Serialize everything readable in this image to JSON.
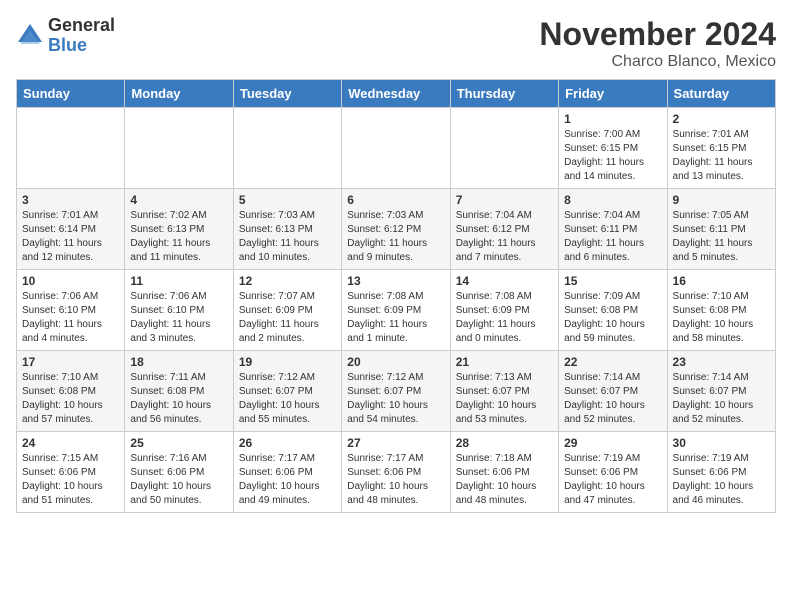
{
  "header": {
    "logo_general": "General",
    "logo_blue": "Blue",
    "month_title": "November 2024",
    "location": "Charco Blanco, Mexico"
  },
  "weekdays": [
    "Sunday",
    "Monday",
    "Tuesday",
    "Wednesday",
    "Thursday",
    "Friday",
    "Saturday"
  ],
  "weeks": [
    [
      {
        "day": "",
        "info": ""
      },
      {
        "day": "",
        "info": ""
      },
      {
        "day": "",
        "info": ""
      },
      {
        "day": "",
        "info": ""
      },
      {
        "day": "",
        "info": ""
      },
      {
        "day": "1",
        "info": "Sunrise: 7:00 AM\nSunset: 6:15 PM\nDaylight: 11 hours and 14 minutes."
      },
      {
        "day": "2",
        "info": "Sunrise: 7:01 AM\nSunset: 6:15 PM\nDaylight: 11 hours and 13 minutes."
      }
    ],
    [
      {
        "day": "3",
        "info": "Sunrise: 7:01 AM\nSunset: 6:14 PM\nDaylight: 11 hours and 12 minutes."
      },
      {
        "day": "4",
        "info": "Sunrise: 7:02 AM\nSunset: 6:13 PM\nDaylight: 11 hours and 11 minutes."
      },
      {
        "day": "5",
        "info": "Sunrise: 7:03 AM\nSunset: 6:13 PM\nDaylight: 11 hours and 10 minutes."
      },
      {
        "day": "6",
        "info": "Sunrise: 7:03 AM\nSunset: 6:12 PM\nDaylight: 11 hours and 9 minutes."
      },
      {
        "day": "7",
        "info": "Sunrise: 7:04 AM\nSunset: 6:12 PM\nDaylight: 11 hours and 7 minutes."
      },
      {
        "day": "8",
        "info": "Sunrise: 7:04 AM\nSunset: 6:11 PM\nDaylight: 11 hours and 6 minutes."
      },
      {
        "day": "9",
        "info": "Sunrise: 7:05 AM\nSunset: 6:11 PM\nDaylight: 11 hours and 5 minutes."
      }
    ],
    [
      {
        "day": "10",
        "info": "Sunrise: 7:06 AM\nSunset: 6:10 PM\nDaylight: 11 hours and 4 minutes."
      },
      {
        "day": "11",
        "info": "Sunrise: 7:06 AM\nSunset: 6:10 PM\nDaylight: 11 hours and 3 minutes."
      },
      {
        "day": "12",
        "info": "Sunrise: 7:07 AM\nSunset: 6:09 PM\nDaylight: 11 hours and 2 minutes."
      },
      {
        "day": "13",
        "info": "Sunrise: 7:08 AM\nSunset: 6:09 PM\nDaylight: 11 hours and 1 minute."
      },
      {
        "day": "14",
        "info": "Sunrise: 7:08 AM\nSunset: 6:09 PM\nDaylight: 11 hours and 0 minutes."
      },
      {
        "day": "15",
        "info": "Sunrise: 7:09 AM\nSunset: 6:08 PM\nDaylight: 10 hours and 59 minutes."
      },
      {
        "day": "16",
        "info": "Sunrise: 7:10 AM\nSunset: 6:08 PM\nDaylight: 10 hours and 58 minutes."
      }
    ],
    [
      {
        "day": "17",
        "info": "Sunrise: 7:10 AM\nSunset: 6:08 PM\nDaylight: 10 hours and 57 minutes."
      },
      {
        "day": "18",
        "info": "Sunrise: 7:11 AM\nSunset: 6:08 PM\nDaylight: 10 hours and 56 minutes."
      },
      {
        "day": "19",
        "info": "Sunrise: 7:12 AM\nSunset: 6:07 PM\nDaylight: 10 hours and 55 minutes."
      },
      {
        "day": "20",
        "info": "Sunrise: 7:12 AM\nSunset: 6:07 PM\nDaylight: 10 hours and 54 minutes."
      },
      {
        "day": "21",
        "info": "Sunrise: 7:13 AM\nSunset: 6:07 PM\nDaylight: 10 hours and 53 minutes."
      },
      {
        "day": "22",
        "info": "Sunrise: 7:14 AM\nSunset: 6:07 PM\nDaylight: 10 hours and 52 minutes."
      },
      {
        "day": "23",
        "info": "Sunrise: 7:14 AM\nSunset: 6:07 PM\nDaylight: 10 hours and 52 minutes."
      }
    ],
    [
      {
        "day": "24",
        "info": "Sunrise: 7:15 AM\nSunset: 6:06 PM\nDaylight: 10 hours and 51 minutes."
      },
      {
        "day": "25",
        "info": "Sunrise: 7:16 AM\nSunset: 6:06 PM\nDaylight: 10 hours and 50 minutes."
      },
      {
        "day": "26",
        "info": "Sunrise: 7:17 AM\nSunset: 6:06 PM\nDaylight: 10 hours and 49 minutes."
      },
      {
        "day": "27",
        "info": "Sunrise: 7:17 AM\nSunset: 6:06 PM\nDaylight: 10 hours and 48 minutes."
      },
      {
        "day": "28",
        "info": "Sunrise: 7:18 AM\nSunset: 6:06 PM\nDaylight: 10 hours and 48 minutes."
      },
      {
        "day": "29",
        "info": "Sunrise: 7:19 AM\nSunset: 6:06 PM\nDaylight: 10 hours and 47 minutes."
      },
      {
        "day": "30",
        "info": "Sunrise: 7:19 AM\nSunset: 6:06 PM\nDaylight: 10 hours and 46 minutes."
      }
    ]
  ]
}
